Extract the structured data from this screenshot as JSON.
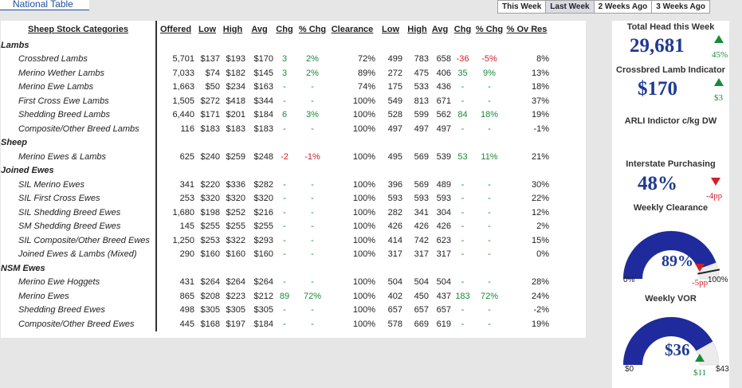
{
  "header": {
    "national_tab": "National Table",
    "weeks": [
      "This Week",
      "Last Week",
      "2 Weeks Ago",
      "3 Weeks Ago"
    ]
  },
  "table": {
    "headers": {
      "category": "Sheep Stock Categories",
      "offered": "Offered",
      "low": "Low",
      "high": "High",
      "avg": "Avg",
      "chg": "Chg",
      "pct_chg": "% Chg",
      "clearance": "Clearance",
      "low2": "Low",
      "high2": "High",
      "avg2": "Avg",
      "chg2": "Chg",
      "pct_chg2": "% Chg",
      "ov_res": "% Ov Res"
    },
    "groups": [
      {
        "name": "Lambs",
        "rows": [
          {
            "c": "Crossbred Lambs",
            "off": "5,701",
            "lo": "$137",
            "hi": "$193",
            "avg": "$170",
            "chg": "3",
            "pchg": "2%",
            "clr": "72%",
            "lo2": "499",
            "hi2": "783",
            "avg2": "658",
            "chg2": "-36",
            "pchg2": "-5%",
            "ovr": "8%"
          },
          {
            "c": "Merino Wether Lambs",
            "off": "7,033",
            "lo": "$74",
            "hi": "$182",
            "avg": "$145",
            "chg": "3",
            "pchg": "2%",
            "clr": "89%",
            "lo2": "272",
            "hi2": "475",
            "avg2": "406",
            "chg2": "35",
            "pchg2": "9%",
            "ovr": "13%"
          },
          {
            "c": "Merino Ewe Lambs",
            "off": "1,663",
            "lo": "$50",
            "hi": "$234",
            "avg": "$163",
            "chg": "-",
            "pchg": "-",
            "clr": "74%",
            "lo2": "175",
            "hi2": "533",
            "avg2": "436",
            "chg2": "-",
            "pchg2": "-",
            "ovr": "18%"
          },
          {
            "c": "First Cross Ewe Lambs",
            "off": "1,505",
            "lo": "$272",
            "hi": "$418",
            "avg": "$344",
            "chg": "-",
            "pchg": "-",
            "clr": "100%",
            "lo2": "549",
            "hi2": "813",
            "avg2": "671",
            "chg2": "-",
            "pchg2": "-",
            "ovr": "37%"
          },
          {
            "c": "Shedding Breed Lambs",
            "off": "6,440",
            "lo": "$171",
            "hi": "$201",
            "avg": "$184",
            "chg": "6",
            "pchg": "3%",
            "clr": "100%",
            "lo2": "528",
            "hi2": "599",
            "avg2": "562",
            "chg2": "84",
            "pchg2": "18%",
            "ovr": "19%"
          },
          {
            "c": "Composite/Other Breed Lambs",
            "off": "116",
            "lo": "$183",
            "hi": "$183",
            "avg": "$183",
            "chg": "-",
            "pchg": "-",
            "clr": "100%",
            "lo2": "497",
            "hi2": "497",
            "avg2": "497",
            "chg2": "-",
            "pchg2": "-",
            "ovr": "-1%"
          }
        ]
      },
      {
        "name": "Sheep",
        "rows": [
          {
            "c": "Merino Ewes & Lambs",
            "off": "625",
            "lo": "$240",
            "hi": "$259",
            "avg": "$248",
            "chg": "-2",
            "pchg": "-1%",
            "clr": "100%",
            "lo2": "495",
            "hi2": "569",
            "avg2": "539",
            "chg2": "53",
            "pchg2": "11%",
            "ovr": "21%"
          }
        ]
      },
      {
        "name": "Joined Ewes",
        "rows": [
          {
            "c": "SIL Merino Ewes",
            "off": "341",
            "lo": "$220",
            "hi": "$336",
            "avg": "$282",
            "chg": "-",
            "pchg": "-",
            "clr": "100%",
            "lo2": "396",
            "hi2": "569",
            "avg2": "489",
            "chg2": "-",
            "pchg2": "-",
            "ovr": "30%"
          },
          {
            "c": "SIL First Cross Ewes",
            "off": "253",
            "lo": "$320",
            "hi": "$320",
            "avg": "$320",
            "chg": "-",
            "pchg": "-",
            "clr": "100%",
            "lo2": "593",
            "hi2": "593",
            "avg2": "593",
            "chg2": "-",
            "pchg2": "-",
            "ovr": "22%"
          },
          {
            "c": "SIL Shedding Breed Ewes",
            "off": "1,680",
            "lo": "$198",
            "hi": "$252",
            "avg": "$216",
            "chg": "-",
            "pchg": "-",
            "clr": "100%",
            "lo2": "282",
            "hi2": "341",
            "avg2": "304",
            "chg2": "-",
            "pchg2": "-",
            "ovr": "12%"
          },
          {
            "c": "SM Shedding Breed Ewes",
            "off": "145",
            "lo": "$255",
            "hi": "$255",
            "avg": "$255",
            "chg": "-",
            "pchg": "-",
            "clr": "100%",
            "lo2": "426",
            "hi2": "426",
            "avg2": "426",
            "chg2": "-",
            "pchg2": "-",
            "ovr": "2%"
          },
          {
            "c": "SIL Composite/Other Breed Ewes",
            "off": "1,250",
            "lo": "$253",
            "hi": "$322",
            "avg": "$293",
            "chg": "-",
            "pchg": "-",
            "clr": "100%",
            "lo2": "414",
            "hi2": "742",
            "avg2": "623",
            "chg2": "-",
            "pchg2": "-",
            "ovr": "15%"
          },
          {
            "c": "Joined Ewes & Lambs (Mixed)",
            "off": "290",
            "lo": "$160",
            "hi": "$160",
            "avg": "$160",
            "chg": "-",
            "pchg": "-",
            "clr": "100%",
            "lo2": "317",
            "hi2": "317",
            "avg2": "317",
            "chg2": "-",
            "pchg2": "-",
            "ovr": "0%"
          }
        ]
      },
      {
        "name": "NSM Ewes",
        "rows": [
          {
            "c": "Merino Ewe Hoggets",
            "off": "431",
            "lo": "$264",
            "hi": "$264",
            "avg": "$264",
            "chg": "-",
            "pchg": "-",
            "clr": "100%",
            "lo2": "504",
            "hi2": "504",
            "avg2": "504",
            "chg2": "-",
            "pchg2": "-",
            "ovr": "28%"
          },
          {
            "c": "Merino Ewes",
            "off": "865",
            "lo": "$208",
            "hi": "$223",
            "avg": "$212",
            "chg": "89",
            "pchg": "72%",
            "clr": "100%",
            "lo2": "402",
            "hi2": "450",
            "avg2": "437",
            "chg2": "183",
            "pchg2": "72%",
            "ovr": "24%"
          },
          {
            "c": "Shedding Breed Ewes",
            "off": "498",
            "lo": "$305",
            "hi": "$305",
            "avg": "$305",
            "chg": "-",
            "pchg": "-",
            "clr": "100%",
            "lo2": "657",
            "hi2": "657",
            "avg2": "657",
            "chg2": "-",
            "pchg2": "-",
            "ovr": "-2%"
          },
          {
            "c": "Composite/Other Breed Ewes",
            "off": "445",
            "lo": "$168",
            "hi": "$197",
            "avg": "$184",
            "chg": "-",
            "pchg": "-",
            "clr": "100%",
            "lo2": "578",
            "hi2": "669",
            "avg2": "619",
            "chg2": "-",
            "pchg2": "-",
            "ovr": "19%"
          }
        ]
      }
    ]
  },
  "side": {
    "head_label": "Total Head this Week",
    "head_value": "29,681",
    "head_change": "45%",
    "cli_label": "Crossbred Lamb Indicator",
    "cli_value": "$170",
    "cli_change": "$3",
    "arli_label": "ARLI Indictor c/kg DW",
    "interstate_label": "Interstate Purchasing",
    "interstate_value": "48%",
    "interstate_change": "-4pp",
    "clearance_label": "Weekly Clearance",
    "clearance_value": "89%",
    "clearance_change": "-5pp",
    "clearance_min": "0%",
    "clearance_max": "100%",
    "clearance_level": 0.89,
    "vor_label": "Weekly VOR",
    "vor_value": "$36",
    "vor_change": "$11",
    "vor_min": "$0",
    "vor_max": "$43",
    "vor_level": 0.837,
    "colors": {
      "gauge": "#1f2a9c",
      "up": "#1a8a3a",
      "down": "#d0202a",
      "track": "#ececec"
    }
  }
}
